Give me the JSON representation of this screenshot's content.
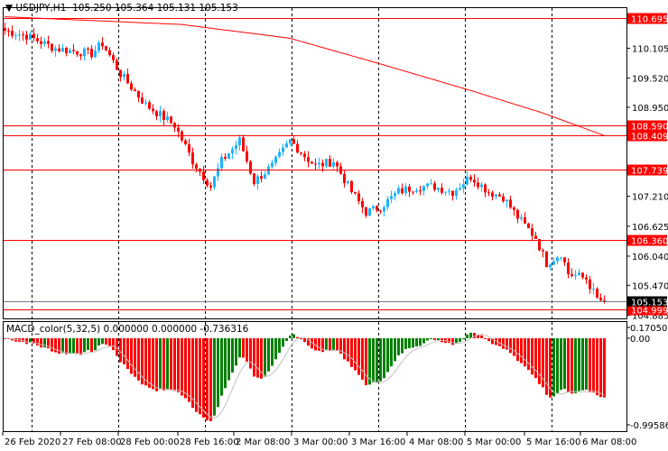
{
  "header": {
    "symbol": "USDJPY,H1",
    "open": "105.250",
    "high": "105.364",
    "low": "105.131",
    "close": "105.153"
  },
  "macd": {
    "title": "MACD_color(5,32,5)",
    "v1": "0.000000",
    "v2": "0.000000",
    "v3": "-0.736316",
    "scale": [
      "0.170505",
      "0.00",
      "-0.99586"
    ]
  },
  "price_scale": [
    "110.105",
    "109.520",
    "108.950",
    "107.210",
    "106.625",
    "106.040",
    "105.470",
    "104.885"
  ],
  "levels": [
    {
      "price": 110.695,
      "label": "110.695"
    },
    {
      "price": 108.59,
      "label": "108.590"
    },
    {
      "price": 108.409,
      "label": "108.409"
    },
    {
      "price": 107.739,
      "label": "107.739"
    },
    {
      "price": 106.36,
      "label": "106.360"
    },
    {
      "price": 104.999,
      "label": "104.999"
    }
  ],
  "current": {
    "price": 105.153,
    "label": "105.153"
  },
  "time_labels": [
    "26 Feb 2020",
    "27 Feb 08:00",
    "28 Feb 00:00",
    "28 Feb 16:00",
    "2 Mar 08:00",
    "3 Mar 00:00",
    "3 Mar 16:00",
    "4 Mar 08:00",
    "5 Mar 00:00",
    "5 Mar 16:00",
    "6 Mar 08:00"
  ],
  "colors": {
    "up": "#1eb4ff",
    "down": "#ff0000",
    "macd_up": "#008000",
    "macd_down": "#ff0000",
    "level": "#ff0000",
    "signal": "#c0c0c0"
  },
  "chart_data": {
    "type": "candlestick",
    "timeframe": "H1",
    "price_path": [
      [
        0,
        110.45
      ],
      [
        6,
        110.35
      ],
      [
        14,
        110.1
      ],
      [
        24,
        110.0
      ],
      [
        27,
        110.2
      ],
      [
        32,
        109.6
      ],
      [
        39,
        109.0
      ],
      [
        47,
        108.6
      ],
      [
        52,
        107.9
      ],
      [
        57,
        107.4
      ],
      [
        60,
        107.9
      ],
      [
        65,
        108.3
      ],
      [
        69,
        107.5
      ],
      [
        74,
        107.8
      ],
      [
        79,
        108.3
      ],
      [
        83,
        108.0
      ],
      [
        86,
        107.8
      ],
      [
        91,
        107.9
      ],
      [
        96,
        107.3
      ],
      [
        100,
        106.9
      ],
      [
        104,
        107.0
      ],
      [
        109,
        107.3
      ],
      [
        114,
        107.4
      ],
      [
        119,
        107.4
      ],
      [
        124,
        107.3
      ],
      [
        129,
        107.6
      ],
      [
        134,
        107.3
      ],
      [
        138,
        107.2
      ],
      [
        142,
        106.8
      ],
      [
        147,
        106.4
      ],
      [
        150,
        105.9
      ],
      [
        154,
        106.1
      ],
      [
        156,
        105.7
      ],
      [
        161,
        105.6
      ],
      [
        164,
        105.2
      ],
      [
        166,
        105.153
      ]
    ],
    "ma_path": [
      [
        0,
        110.72
      ],
      [
        49,
        110.57
      ],
      [
        79,
        110.3
      ],
      [
        104,
        109.8
      ],
      [
        129,
        109.28
      ],
      [
        149,
        108.84
      ],
      [
        166,
        108.4
      ]
    ]
  }
}
